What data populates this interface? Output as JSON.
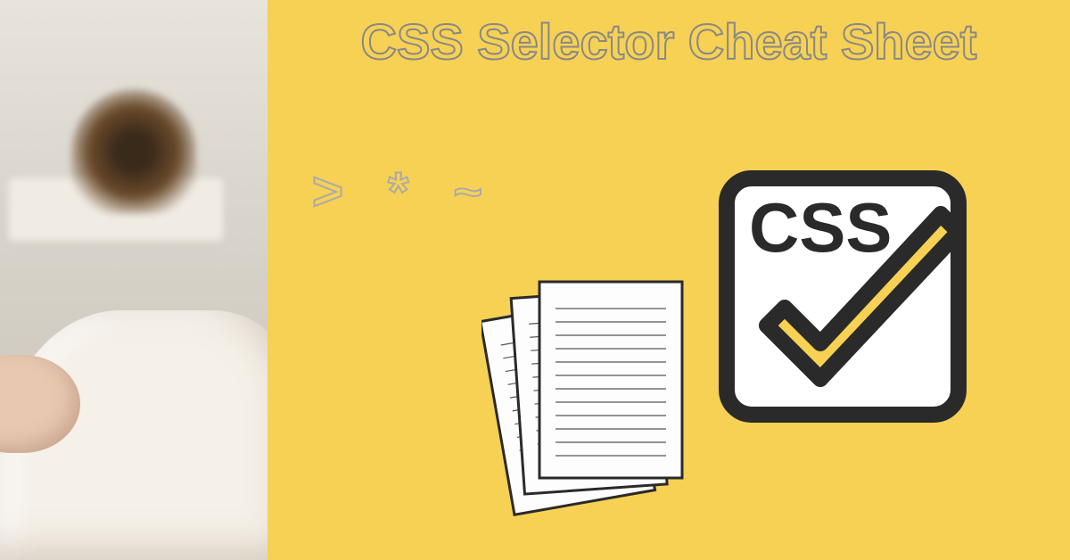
{
  "title": "CSS Selector Cheat Sheet",
  "symbols": {
    "gt": ">",
    "star": "*",
    "tilde": "~"
  },
  "badge_label": "CSS",
  "colors": {
    "bg": "#f7d154",
    "outline": "#888"
  }
}
